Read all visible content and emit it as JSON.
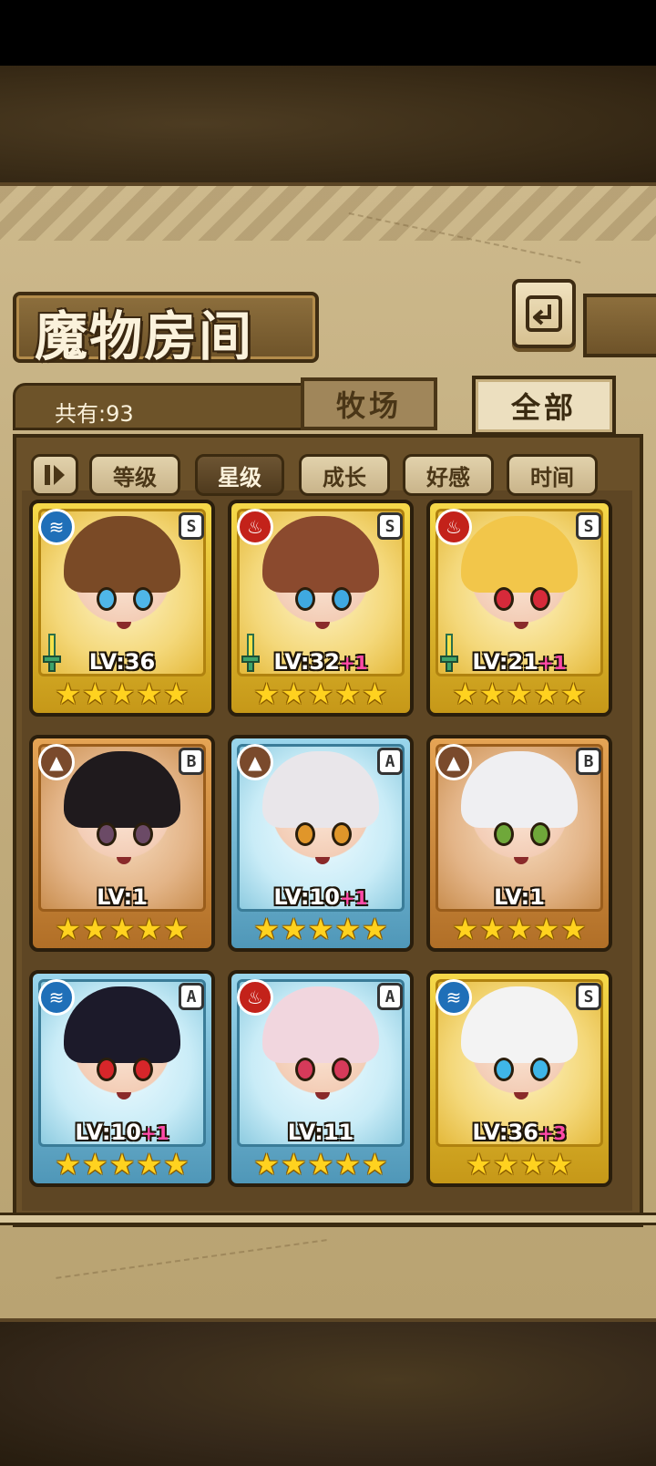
{
  "screen": {
    "title": "魔物房间",
    "count_label": "共有:93"
  },
  "tabs": [
    {
      "label": "牧场",
      "active": false
    },
    {
      "label": "全部",
      "active": true
    }
  ],
  "filters": [
    {
      "label": "等级",
      "active": false
    },
    {
      "label": "星级",
      "active": true
    },
    {
      "label": "成长",
      "active": false
    },
    {
      "label": "好感",
      "active": false
    },
    {
      "label": "时间",
      "active": false
    }
  ],
  "monsters": [
    {
      "lv": "LV:36",
      "plus": "",
      "rank": "S",
      "element": "water",
      "frame": "gold",
      "hair": "#7a4a26",
      "eye": "#4fb6e8",
      "stars": 5,
      "sword": true
    },
    {
      "lv": "LV:32",
      "plus": "+1",
      "rank": "S",
      "element": "fire",
      "frame": "gold",
      "hair": "#8b4a2e",
      "eye": "#3fa9e0",
      "stars": 5,
      "sword": true
    },
    {
      "lv": "LV:21",
      "plus": "+1",
      "rank": "S",
      "element": "fire",
      "frame": "gold",
      "hair": "#f2c64a",
      "eye": "#d62a3a",
      "stars": 5,
      "sword": true
    },
    {
      "lv": "LV:1",
      "plus": "",
      "rank": "B",
      "element": "earth",
      "frame": "bronze",
      "hair": "#1f1a1d",
      "eye": "#6b4a66",
      "stars": 5,
      "sword": false
    },
    {
      "lv": "LV:10",
      "plus": "+1",
      "rank": "A",
      "element": "earth",
      "frame": "blue",
      "hair": "#e9e6ea",
      "eye": "#e0962a",
      "stars": 5,
      "sword": false
    },
    {
      "lv": "LV:1",
      "plus": "",
      "rank": "B",
      "element": "earth",
      "frame": "bronze",
      "hair": "#efeff2",
      "eye": "#6fa83a",
      "stars": 5,
      "sword": false
    },
    {
      "lv": "LV:10",
      "plus": "+1",
      "rank": "A",
      "element": "water",
      "frame": "blue",
      "hair": "#1c1a2a",
      "eye": "#d7262a",
      "stars": 5,
      "sword": false
    },
    {
      "lv": "LV:11",
      "plus": "",
      "rank": "A",
      "element": "fire",
      "frame": "blue",
      "hair": "#f1d6de",
      "eye": "#d63a5a",
      "stars": 5,
      "sword": false
    },
    {
      "lv": "LV:36",
      "plus": "+3",
      "rank": "S",
      "element": "water",
      "frame": "gold",
      "hair": "#f3f3f3",
      "eye": "#3fb6e8",
      "stars": 4,
      "sword": false
    }
  ],
  "icons": {
    "back": "back-arrow-icon",
    "sort": "sort-toggle-icon",
    "water": "water-element-icon",
    "fire": "fire-element-icon",
    "earth": "earth-element-icon",
    "star": "star-icon"
  }
}
